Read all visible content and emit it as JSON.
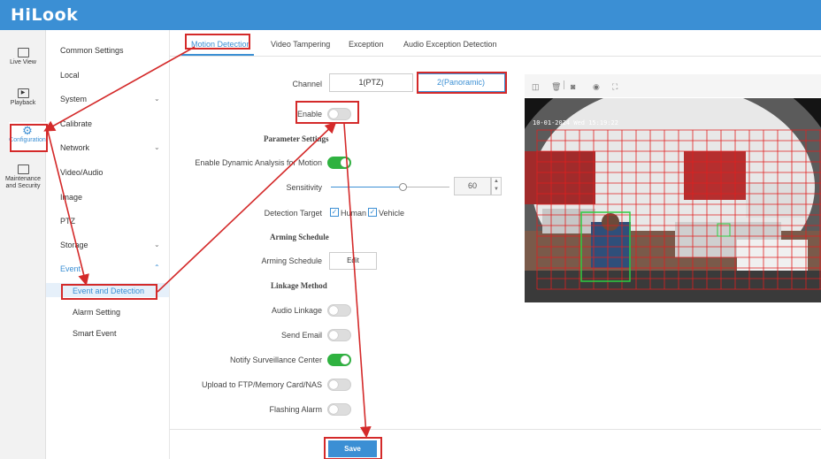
{
  "app": {
    "logo": "HiLook"
  },
  "rail": {
    "items": [
      {
        "label": "Live View"
      },
      {
        "label": "Playback"
      },
      {
        "label": "Configuration"
      },
      {
        "label_line1": "Maintenance",
        "label_line2": "and Security"
      }
    ]
  },
  "menu": {
    "common_settings": "Common Settings",
    "local": "Local",
    "system": "System",
    "calibrate": "Calibrate",
    "network": "Network",
    "video_audio": "Video/Audio",
    "image": "Image",
    "ptz": "PTZ",
    "storage": "Storage",
    "event": "Event",
    "event_and_detection": "Event and Detection",
    "alarm_setting": "Alarm Setting",
    "smart_event": "Smart Event"
  },
  "tabs": [
    "Motion Detection",
    "Video Tampering",
    "Exception",
    "Audio Exception Detection"
  ],
  "form": {
    "channel_label": "Channel",
    "channel_options": [
      "1(PTZ)",
      "2(Panoramic)"
    ],
    "channel_selected": "2(Panoramic)",
    "enable_label": "Enable",
    "enable_on": false,
    "parameter_settings": "Parameter Settings",
    "dynamic_analysis_label": "Enable Dynamic Analysis for Motion",
    "dynamic_analysis_on": true,
    "sensitivity_label": "Sensitivity",
    "sensitivity_value": "60",
    "detection_target_label": "Detection Target",
    "target_human": "Human",
    "target_vehicle": "Vehicle",
    "arming_schedule_section": "Arming Schedule",
    "arming_schedule_label": "Arming Schedule",
    "edit_label": "Edit",
    "linkage_section": "Linkage Method",
    "audio_linkage_label": "Audio Linkage",
    "audio_linkage_on": false,
    "send_email_label": "Send Email",
    "send_email_on": false,
    "notify_center_label": "Notify Surveillance Center",
    "notify_center_on": true,
    "upload_label": "Upload to FTP/Memory Card/NAS",
    "upload_on": false,
    "flashing_alarm_label": "Flashing Alarm",
    "flashing_alarm_on": false,
    "save_label": "Save"
  },
  "video": {
    "osd_text": "10-01-2024 Wed 15:19:22"
  },
  "colors": {
    "accent": "#3b8fd4",
    "toggle_on": "#2fb240",
    "annotation": "#d42a2a",
    "motion_grid": "#e02020",
    "target_box": "#2ecc40"
  }
}
